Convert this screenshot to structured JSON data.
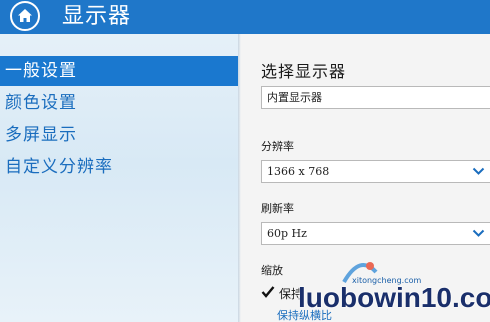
{
  "header": {
    "title": "显示器",
    "icon": "home-icon"
  },
  "sidebar": {
    "items": [
      {
        "label": "一般设置",
        "active": true
      },
      {
        "label": "颜色设置",
        "active": false
      },
      {
        "label": "多屏显示",
        "active": false
      },
      {
        "label": "自定义分辨率",
        "active": false
      }
    ]
  },
  "main": {
    "select_display": {
      "title": "选择显示器",
      "value": "内置显示器"
    },
    "resolution": {
      "label": "分辨率",
      "value": "1366 x 768"
    },
    "refresh": {
      "label": "刷新率",
      "value": "60p Hz"
    },
    "scaling": {
      "label": "缩放",
      "checkbox_label": "保持",
      "checked": true,
      "link": "保持纵横比"
    }
  },
  "watermark": {
    "text": "luobowin10.com",
    "sub": "xitongcheng.com"
  },
  "colors": {
    "accent": "#1f77c9",
    "sidebar_text": "#1a6dbe",
    "active_item": "#1a78cf"
  }
}
